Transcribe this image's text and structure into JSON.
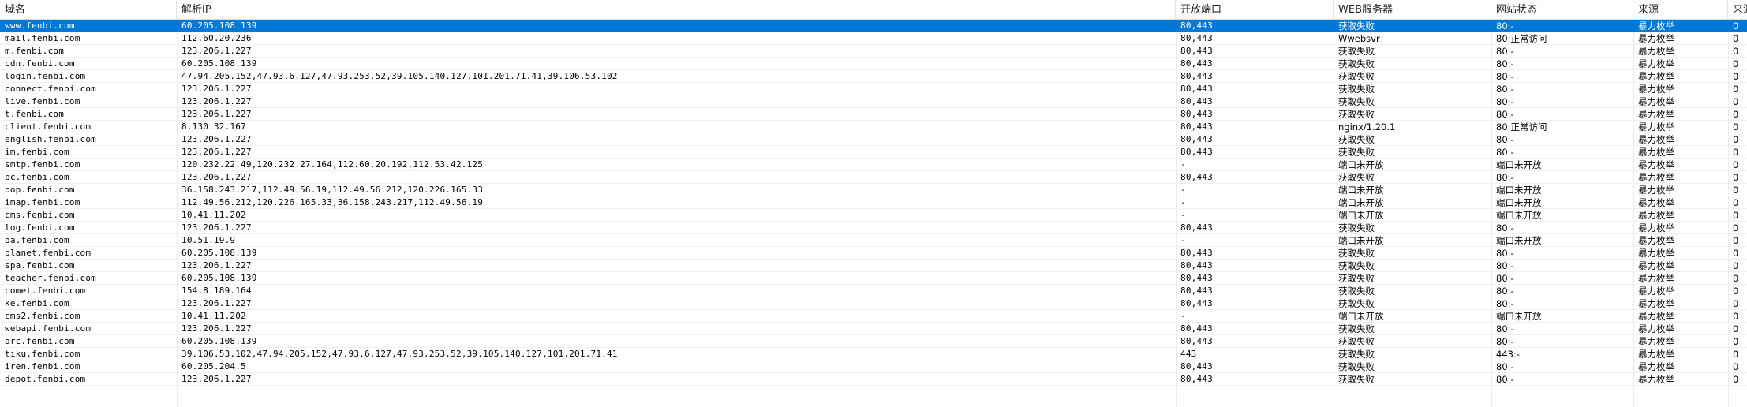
{
  "columns": [
    "域名",
    "解析IP",
    "开放端口",
    "WEB服务器",
    "网站状态",
    "来源",
    "来源"
  ],
  "rows": [
    [
      "www.fenbi.com",
      "60.205.108.139",
      "80,443",
      "获取失败",
      "80:-",
      "暴力枚举",
      "0"
    ],
    [
      "mail.fenbi.com",
      "112.60.20.236",
      "80,443",
      "Wwebsvr",
      "80:正常访问",
      "暴力枚举",
      "0"
    ],
    [
      "m.fenbi.com",
      "123.206.1.227",
      "80,443",
      "获取失败",
      "80:-",
      "暴力枚举",
      "0"
    ],
    [
      "cdn.fenbi.com",
      "60.205.108.139",
      "80,443",
      "获取失败",
      "80:-",
      "暴力枚举",
      "0"
    ],
    [
      "login.fenbi.com",
      "47.94.205.152,47.93.6.127,47.93.253.52,39.105.140.127,101.201.71.41,39.106.53.102",
      "80,443",
      "获取失败",
      "80:-",
      "暴力枚举",
      "0"
    ],
    [
      "connect.fenbi.com",
      "123.206.1.227",
      "80,443",
      "获取失败",
      "80:-",
      "暴力枚举",
      "0"
    ],
    [
      "live.fenbi.com",
      "123.206.1.227",
      "80,443",
      "获取失败",
      "80:-",
      "暴力枚举",
      "0"
    ],
    [
      "t.fenbi.com",
      "123.206.1.227",
      "80,443",
      "获取失败",
      "80:-",
      "暴力枚举",
      "0"
    ],
    [
      "client.fenbi.com",
      "8.130.32.167",
      "80,443",
      "nginx/1.20.1",
      "80:正常访问",
      "暴力枚举",
      "0"
    ],
    [
      "english.fenbi.com",
      "123.206.1.227",
      "80,443",
      "获取失败",
      "80:-",
      "暴力枚举",
      "0"
    ],
    [
      "im.fenbi.com",
      "123.206.1.227",
      "80,443",
      "获取失败",
      "80:-",
      "暴力枚举",
      "0"
    ],
    [
      "smtp.fenbi.com",
      "120.232.22.49,120.232.27.164,112.60.20.192,112.53.42.125",
      "-",
      "端口未开放",
      "端口未开放",
      "暴力枚举",
      "0"
    ],
    [
      "pc.fenbi.com",
      "123.206.1.227",
      "80,443",
      "获取失败",
      "80:-",
      "暴力枚举",
      "0"
    ],
    [
      "pop.fenbi.com",
      "36.158.243.217,112.49.56.19,112.49.56.212,120.226.165.33",
      "-",
      "端口未开放",
      "端口未开放",
      "暴力枚举",
      "0"
    ],
    [
      "imap.fenbi.com",
      "112.49.56.212,120.226.165.33,36.158.243.217,112.49.56.19",
      "-",
      "端口未开放",
      "端口未开放",
      "暴力枚举",
      "0"
    ],
    [
      "cms.fenbi.com",
      "10.41.11.202",
      "-",
      "端口未开放",
      "端口未开放",
      "暴力枚举",
      "0"
    ],
    [
      "log.fenbi.com",
      "123.206.1.227",
      "80,443",
      "获取失败",
      "80:-",
      "暴力枚举",
      "0"
    ],
    [
      "oa.fenbi.com",
      "10.51.19.9",
      "-",
      "端口未开放",
      "端口未开放",
      "暴力枚举",
      "0"
    ],
    [
      "planet.fenbi.com",
      "60.205.108.139",
      "80,443",
      "获取失败",
      "80:-",
      "暴力枚举",
      "0"
    ],
    [
      "spa.fenbi.com",
      "123.206.1.227",
      "80,443",
      "获取失败",
      "80:-",
      "暴力枚举",
      "0"
    ],
    [
      "teacher.fenbi.com",
      "60.205.108.139",
      "80,443",
      "获取失败",
      "80:-",
      "暴力枚举",
      "0"
    ],
    [
      "comet.fenbi.com",
      "154.8.189.164",
      "80,443",
      "获取失败",
      "80:-",
      "暴力枚举",
      "0"
    ],
    [
      "ke.fenbi.com",
      "123.206.1.227",
      "80,443",
      "获取失败",
      "80:-",
      "暴力枚举",
      "0"
    ],
    [
      "cms2.fenbi.com",
      "10.41.11.202",
      "-",
      "端口未开放",
      "端口未开放",
      "暴力枚举",
      "0"
    ],
    [
      "webapi.fenbi.com",
      "123.206.1.227",
      "80,443",
      "获取失败",
      "80:-",
      "暴力枚举",
      "0"
    ],
    [
      "orc.fenbi.com",
      "60.205.108.139",
      "80,443",
      "获取失败",
      "80:-",
      "暴力枚举",
      "0"
    ],
    [
      "tiku.fenbi.com",
      "39.106.53.102,47.94.205.152,47.93.6.127,47.93.253.52,39.105.140.127,101.201.71.41",
      "443",
      "获取失败",
      "443:-",
      "暴力枚举",
      "0"
    ],
    [
      "iren.fenbi.com",
      "60.205.204.5",
      "80,443",
      "获取失败",
      "80:-",
      "暴力枚举",
      "0"
    ],
    [
      "depot.fenbi.com",
      "123.206.1.227",
      "80,443",
      "获取失败",
      "80:-",
      "暴力枚举",
      "0"
    ]
  ],
  "selected_row": 0
}
